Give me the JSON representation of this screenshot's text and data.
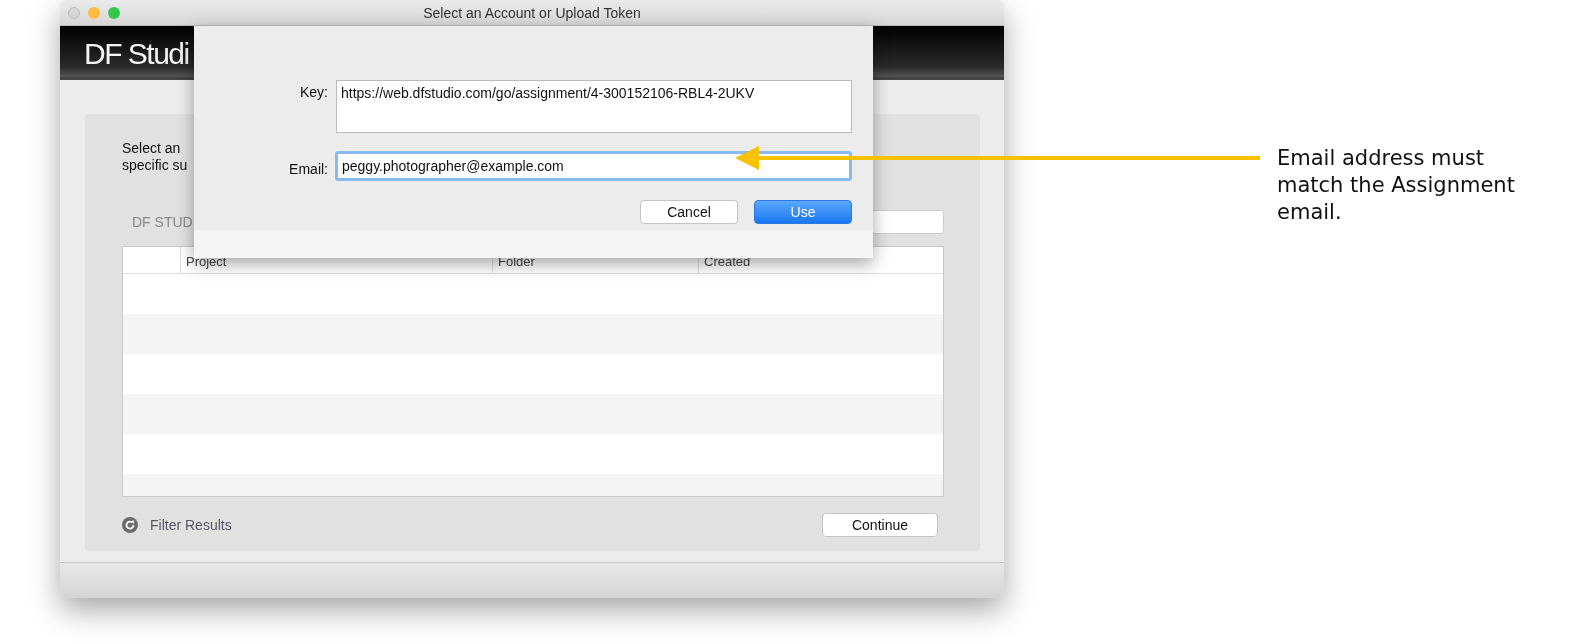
{
  "window": {
    "title": "Select an Account or Upload Token",
    "logo": "DF Studi"
  },
  "main": {
    "intro_lines": [
      "Select an",
      "specific su"
    ],
    "source_label": "DF STUD",
    "table": {
      "columns": [
        "",
        "Project",
        "Folder",
        "Created"
      ]
    },
    "filter": "Filter Results",
    "continue_button": "Continue"
  },
  "sheet": {
    "key_label": "Key:",
    "key_value": "https://web.dfstudio.com/go/assignment/4-300152106-RBL4-2UKV",
    "email_label": "Email:",
    "email_value": "peggy.photographer@example.com",
    "email_focused": true,
    "buttons": [
      {
        "label": "Cancel",
        "primary": false
      },
      {
        "label": "Use",
        "primary": true
      }
    ]
  },
  "annotation": {
    "text": "Email address must match the Assignment email."
  }
}
